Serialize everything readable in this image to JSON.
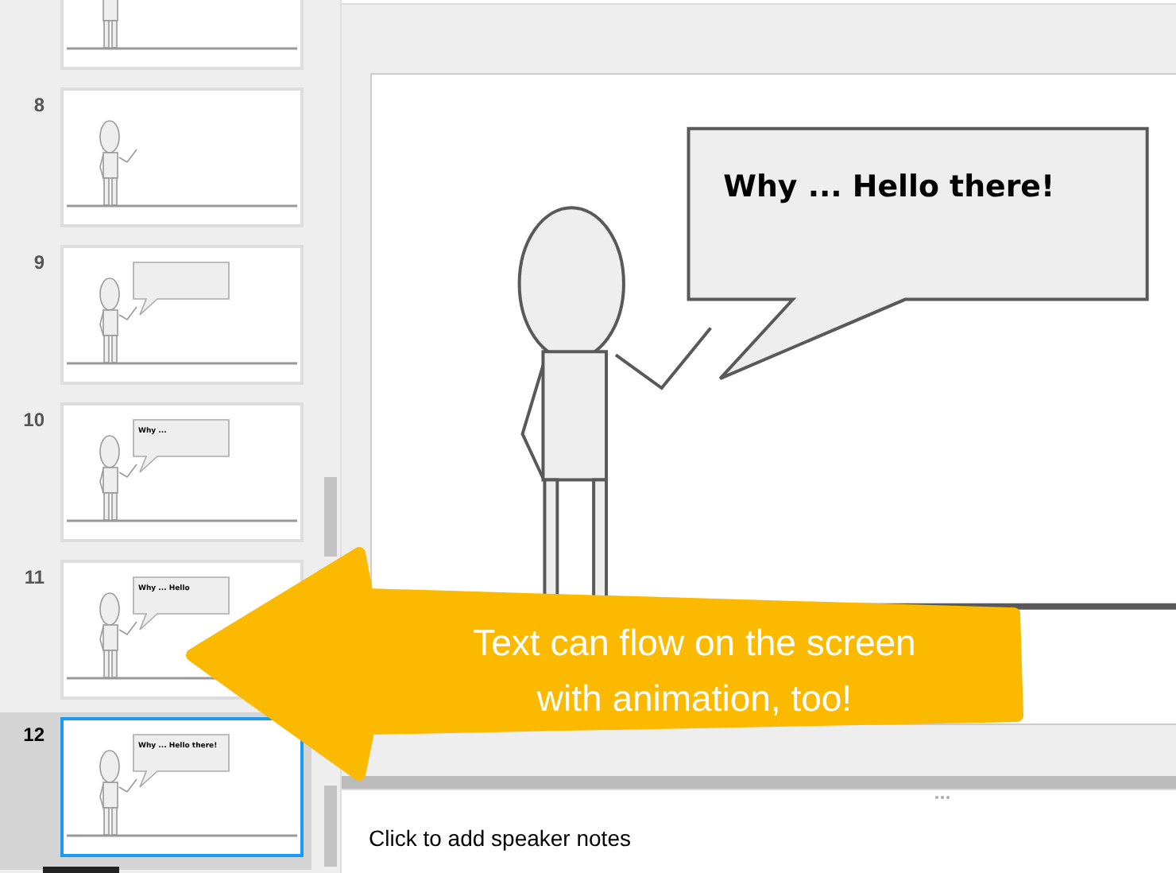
{
  "slides": [
    {
      "kind": "cropped",
      "bubble": false,
      "selected": false
    },
    {
      "number": "8",
      "kind": "full",
      "bubble": false,
      "selected": false
    },
    {
      "number": "9",
      "kind": "full",
      "bubble": true,
      "selected": false
    },
    {
      "number": "10",
      "kind": "full",
      "bubble": true,
      "bubble_text": "Why ...",
      "selected": false
    },
    {
      "number": "11",
      "kind": "full",
      "bubble": true,
      "bubble_text": "Why ... Hello",
      "selected": false
    },
    {
      "number": "12",
      "kind": "full",
      "bubble": true,
      "bubble_text": "Why ... Hello there!",
      "selected": true
    }
  ],
  "current_slide": {
    "speech_bubble": {
      "text": "Why ... Hello there!"
    }
  },
  "callout": {
    "text": "Text can flow on the screen with animation, too!"
  },
  "speaker_notes": {
    "placeholder": "Click to add speaker notes"
  }
}
